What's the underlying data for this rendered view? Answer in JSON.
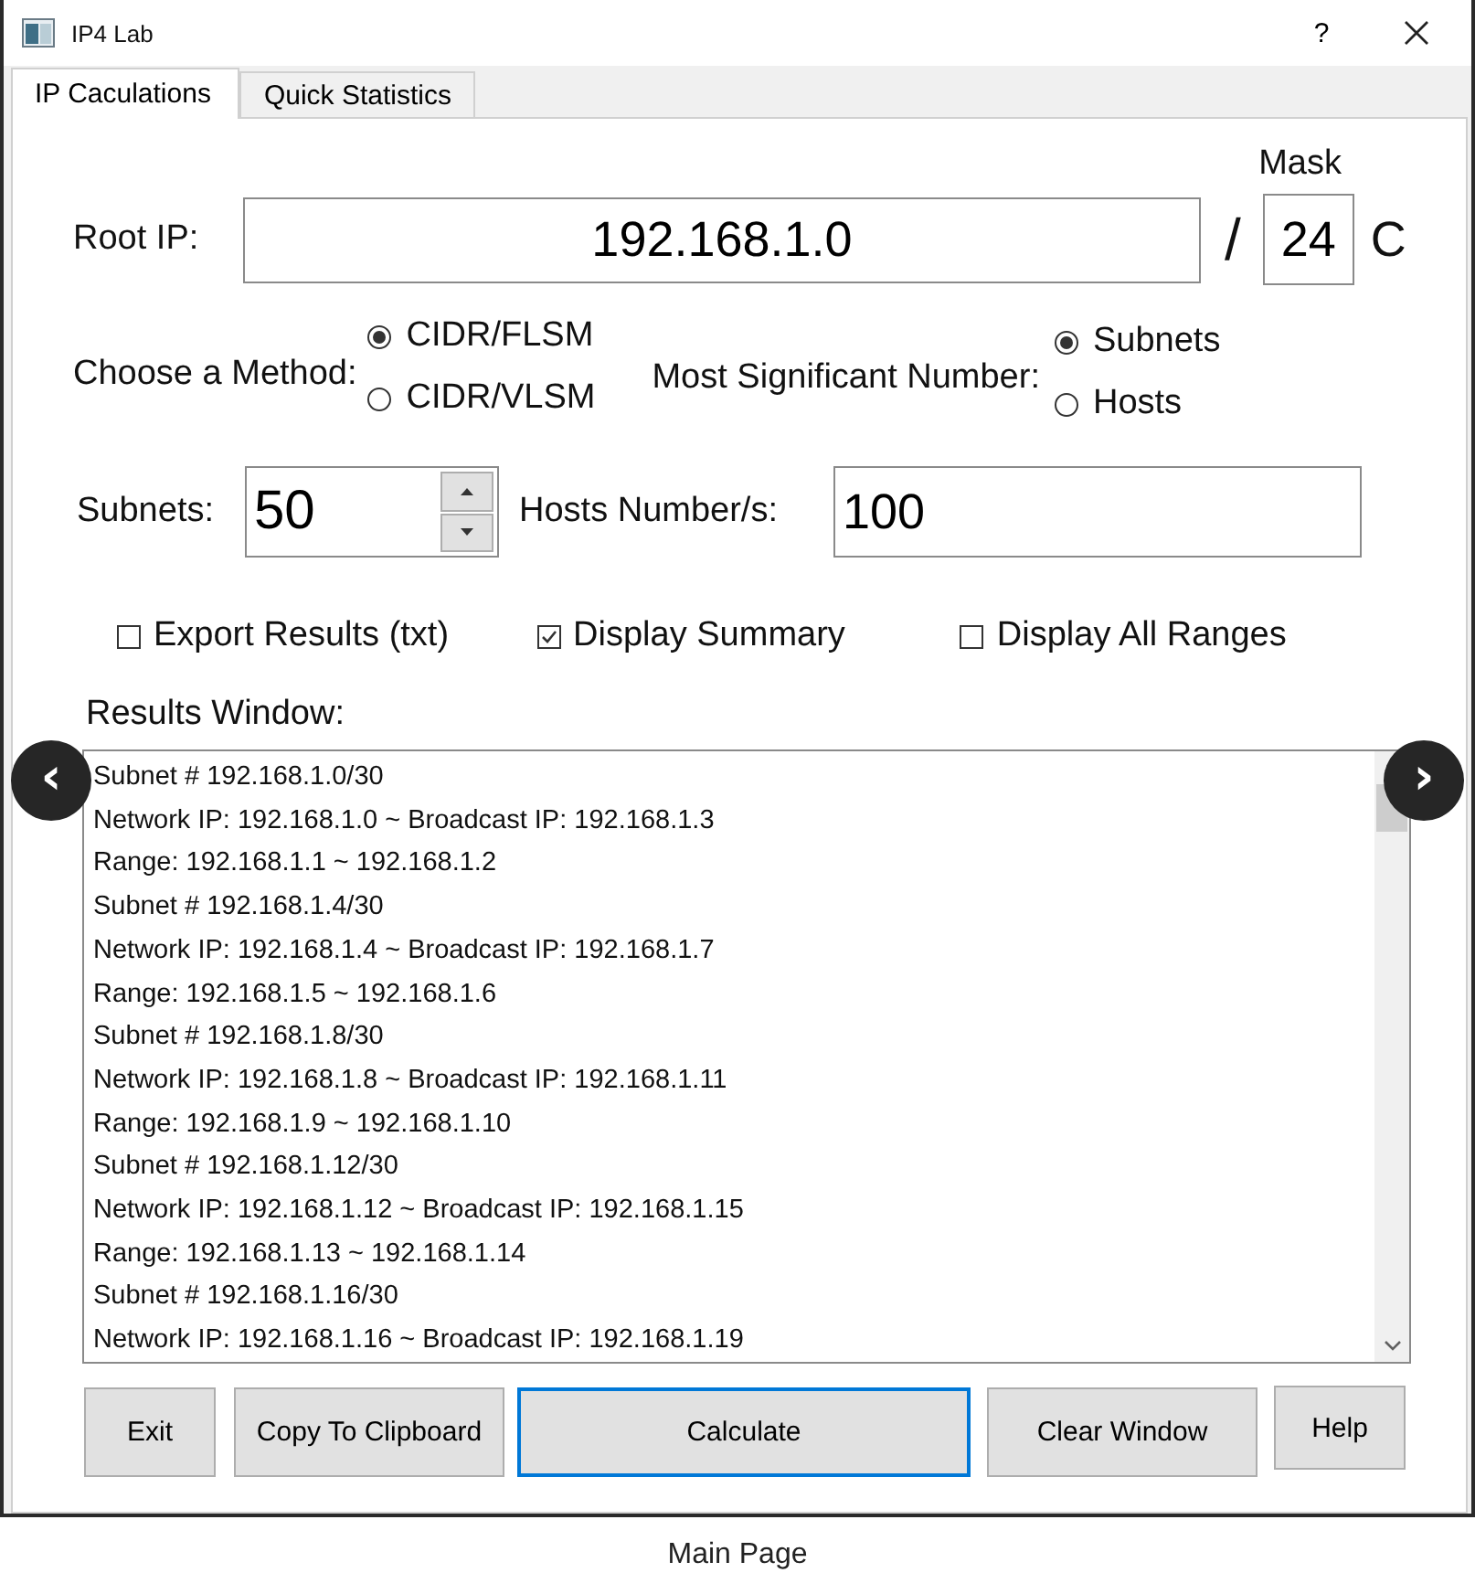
{
  "window": {
    "title": "IP4 Lab",
    "help": "?"
  },
  "tabs": [
    {
      "label": "IP Caculations",
      "selected": true
    },
    {
      "label": "Quick Statistics",
      "selected": false
    }
  ],
  "root_ip": {
    "label": "Root IP:",
    "value": "192.168.1.0",
    "slash": "/",
    "mask_label": "Mask",
    "mask": "24",
    "class": "C"
  },
  "method": {
    "label": "Choose a Method:",
    "options": [
      {
        "label": "CIDR/FLSM",
        "selected": true
      },
      {
        "label": "CIDR/VLSM",
        "selected": false
      }
    ]
  },
  "significant": {
    "label": "Most Significant Number:",
    "options": [
      {
        "label": "Subnets",
        "selected": true
      },
      {
        "label": "Hosts",
        "selected": false
      }
    ]
  },
  "subnets": {
    "label": "Subnets:",
    "value": "50"
  },
  "hosts": {
    "label": "Hosts Number/s:",
    "value": "100"
  },
  "checkboxes": [
    {
      "label": "Export Results (txt)",
      "checked": false
    },
    {
      "label": "Display Summary",
      "checked": true
    },
    {
      "label": "Display All Ranges",
      "checked": false
    }
  ],
  "results": {
    "label": "Results Window:",
    "lines": [
      "Subnet # 192.168.1.0/30",
      "Network IP: 192.168.1.0 ~ Broadcast IP: 192.168.1.3",
      "Range: 192.168.1.1 ~ 192.168.1.2",
      "Subnet # 192.168.1.4/30",
      "Network IP: 192.168.1.4 ~ Broadcast IP: 192.168.1.7",
      "Range: 192.168.1.5 ~ 192.168.1.6",
      "Subnet # 192.168.1.8/30",
      "Network IP: 192.168.1.8 ~ Broadcast IP: 192.168.1.11",
      "Range: 192.168.1.9 ~ 192.168.1.10",
      "Subnet # 192.168.1.12/30",
      "Network IP: 192.168.1.12 ~ Broadcast IP: 192.168.1.15",
      "Range: 192.168.1.13 ~ 192.168.1.14",
      "Subnet # 192.168.1.16/30",
      "Network IP: 192.168.1.16 ~ Broadcast IP: 192.168.1.19"
    ]
  },
  "buttons": [
    {
      "label": "Exit",
      "selected": false
    },
    {
      "label": "Copy To Clipboard",
      "selected": false
    },
    {
      "label": "Calculate",
      "selected": true
    },
    {
      "label": "Clear Window",
      "selected": false
    },
    {
      "label": "Help",
      "selected": false
    }
  ],
  "carousel": {
    "previous": "‹",
    "next": "›"
  },
  "caption": "Main Page"
}
